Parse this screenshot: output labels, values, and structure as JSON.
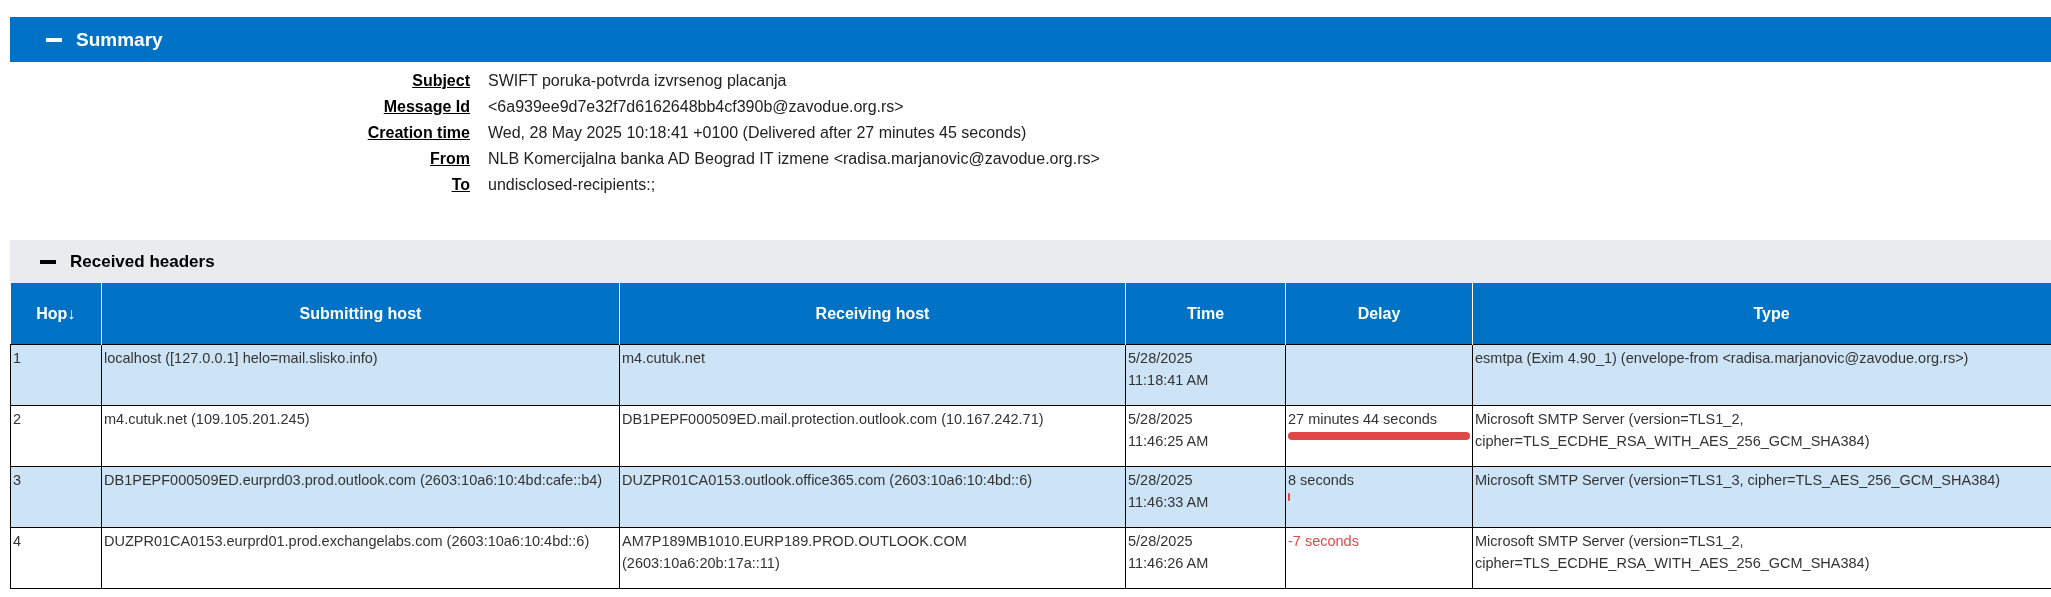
{
  "summary": {
    "title": "Summary",
    "expanded": true,
    "fields": [
      {
        "label": "Subject",
        "value": "SWIFT poruka-potvrda izvrsenog placanja"
      },
      {
        "label": "Message Id",
        "value": "<6a939ee9d7e32f7d6162648bb4cf390b@zavodue.org.rs>"
      },
      {
        "label": "Creation time",
        "value": "Wed, 28 May 2025 10:18:41 +0100 (Delivered after 27 minutes 45 seconds)"
      },
      {
        "label": "From",
        "value": "NLB Komercijalna banka AD Beograd IT izmene <radisa.marjanovic@zavodue.org.rs>"
      },
      {
        "label": "To",
        "value": "undisclosed-recipients:;"
      }
    ]
  },
  "received": {
    "title": "Received headers",
    "expanded": true,
    "columns": [
      "Hop↓",
      "Submitting host",
      "Receiving host",
      "Time",
      "Delay",
      "Type"
    ],
    "rows": [
      {
        "hop": "1",
        "submitting": "localhost ([127.0.0.1] helo=mail.slisko.info)",
        "receiving": "m4.cutuk.net",
        "time": [
          "5/28/2025",
          "11:18:41 AM"
        ],
        "type": "esmtpa (Exim 4.90_1) (envelope-from <radisa.marjanovic@zavodue.org.rs>)"
      },
      {
        "hop": "2",
        "submitting": "m4.cutuk.net (109.105.201.245)",
        "receiving": "DB1PEPF000509ED.mail.protection.outlook.com (10.167.242.71)",
        "time": [
          "5/28/2025",
          "11:46:25 AM"
        ],
        "delay": "27 minutes 44 seconds",
        "level": 1,
        "negative": false,
        "type": "Microsoft SMTP Server (version=TLS1_2, cipher=TLS_ECDHE_RSA_WITH_AES_256_GCM_SHA384)"
      },
      {
        "hop": "3",
        "submitting": "DB1PEPF000509ED.eurprd03.prod.outlook.com (2603:10a6:10:4bd:cafe::b4)",
        "receiving": "DUZPR01CA0153.outlook.office365.com (2603:10a6:10:4bd::6)",
        "time": [
          "5/28/2025",
          "11:46:33 AM"
        ],
        "delay": "8 seconds",
        "level": 0.005,
        "negative": false,
        "type": "Microsoft SMTP Server (version=TLS1_3, cipher=TLS_AES_256_GCM_SHA384)"
      },
      {
        "hop": "4",
        "submitting": "DUZPR01CA0153.eurprd01.prod.exchangelabs.com (2603:10a6:10:4bd::6)",
        "receiving": "AM7P189MB1010.EURP189.PROD.OUTLOOK.COM (2603:10a6:20b:17a::11)",
        "time": [
          "5/28/2025",
          "11:46:26 AM"
        ],
        "delay": "-7 seconds",
        "negative": true,
        "type": "Microsoft SMTP Server (version=TLS1_2, cipher=TLS_ECDHE_RSA_WITH_AES_256_GCM_SHA384)"
      }
    ]
  }
}
